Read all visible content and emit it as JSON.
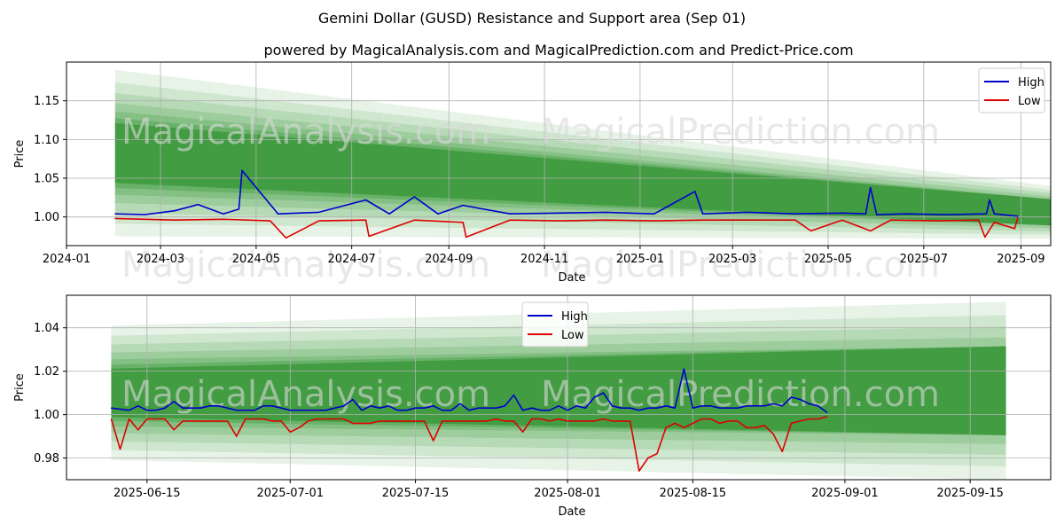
{
  "title": "Gemini Dollar (GUSD) Resistance and Support area (Sep 01)",
  "subtitle": "powered by MagicalAnalysis.com and MagicalPrediction.com and Predict-Price.com",
  "watermarks": [
    "MagicalAnalysis.com",
    "MagicalPrediction.com"
  ],
  "colors": {
    "high": "#0000cc",
    "low": "#dd0000",
    "band": "#228b22",
    "grid": "#b0b0b0"
  },
  "chart_data": [
    {
      "type": "line",
      "xlabel": "Date",
      "ylabel": "Price",
      "xlim": [
        "2024-01-01",
        "2025-09-20"
      ],
      "ylim": [
        0.963,
        1.2
      ],
      "x_ticks": [
        "2024-01",
        "2024-03",
        "2024-05",
        "2024-07",
        "2024-09",
        "2024-11",
        "2025-01",
        "2025-03",
        "2025-05",
        "2025-07",
        "2025-09"
      ],
      "y_ticks": [
        "1.00",
        "1.05",
        "1.10",
        "1.15"
      ],
      "legend": "top-right",
      "grid": true,
      "band": {
        "x_start": "2024-02-01",
        "x_end": "2025-09-20",
        "start_upper": 1.19,
        "start_lower": 0.975,
        "end_upper": 1.04,
        "end_lower": 0.972
      },
      "series": [
        {
          "name": "High",
          "x": [
            "2024-02-01",
            "2024-02-20",
            "2024-03-10",
            "2024-03-25",
            "2024-04-10",
            "2024-04-20",
            "2024-04-22",
            "2024-05-15",
            "2024-06-10",
            "2024-07-10",
            "2024-07-25",
            "2024-08-10",
            "2024-08-25",
            "2024-09-10",
            "2024-10-10",
            "2024-11-10",
            "2024-12-10",
            "2025-01-10",
            "2025-02-05",
            "2025-02-10",
            "2025-03-10",
            "2025-04-10",
            "2025-05-10",
            "2025-05-25",
            "2025-05-28",
            "2025-06-01",
            "2025-06-20",
            "2025-07-15",
            "2025-08-10",
            "2025-08-12",
            "2025-08-15",
            "2025-08-30"
          ],
          "values": [
            1.004,
            1.003,
            1.008,
            1.016,
            1.004,
            1.01,
            1.06,
            1.004,
            1.006,
            1.022,
            1.004,
            1.026,
            1.004,
            1.015,
            1.004,
            1.005,
            1.006,
            1.004,
            1.033,
            1.004,
            1.006,
            1.004,
            1.005,
            1.004,
            1.038,
            1.003,
            1.004,
            1.003,
            1.004,
            1.022,
            1.004,
            1.001
          ]
        },
        {
          "name": "Low",
          "x": [
            "2024-02-01",
            "2024-03-10",
            "2024-04-10",
            "2024-05-10",
            "2024-05-20",
            "2024-06-10",
            "2024-07-10",
            "2024-07-12",
            "2024-08-10",
            "2024-09-10",
            "2024-09-12",
            "2024-10-10",
            "2024-11-10",
            "2024-12-10",
            "2025-01-10",
            "2025-02-10",
            "2025-03-10",
            "2025-04-10",
            "2025-04-20",
            "2025-05-10",
            "2025-05-28",
            "2025-06-10",
            "2025-07-10",
            "2025-08-05",
            "2025-08-09",
            "2025-08-15",
            "2025-08-28",
            "2025-08-30"
          ],
          "values": [
            0.998,
            0.996,
            0.997,
            0.995,
            0.973,
            0.995,
            0.996,
            0.975,
            0.996,
            0.993,
            0.974,
            0.996,
            0.995,
            0.996,
            0.995,
            0.996,
            0.996,
            0.996,
            0.982,
            0.996,
            0.982,
            0.996,
            0.995,
            0.996,
            0.974,
            0.993,
            0.985,
            0.999
          ]
        }
      ]
    },
    {
      "type": "line",
      "xlabel": "Date",
      "ylabel": "Price",
      "xlim": [
        "2025-06-06",
        "2025-09-24"
      ],
      "ylim": [
        0.97,
        1.055
      ],
      "x_ticks": [
        "2025-06-15",
        "2025-07-01",
        "2025-07-15",
        "2025-08-01",
        "2025-08-15",
        "2025-09-01",
        "2025-09-15"
      ],
      "y_ticks": [
        "0.98",
        "1.00",
        "1.02",
        "1.04"
      ],
      "legend": "top-center",
      "grid": true,
      "band": {
        "x_start": "2025-06-11",
        "x_end": "2025-09-19",
        "start_upper": 1.041,
        "start_lower": 0.979,
        "end_upper": 1.052,
        "end_lower": 0.97
      },
      "series": [
        {
          "name": "High",
          "x": [
            "2025-06-11",
            "2025-06-13",
            "2025-06-14",
            "2025-06-15",
            "2025-06-16",
            "2025-06-17",
            "2025-06-18",
            "2025-06-19",
            "2025-06-20",
            "2025-06-21",
            "2025-06-22",
            "2025-06-23",
            "2025-06-24",
            "2025-06-25",
            "2025-06-26",
            "2025-06-27",
            "2025-06-28",
            "2025-06-29",
            "2025-06-30",
            "2025-07-01",
            "2025-07-02",
            "2025-07-03",
            "2025-07-04",
            "2025-07-05",
            "2025-07-06",
            "2025-07-07",
            "2025-07-08",
            "2025-07-09",
            "2025-07-10",
            "2025-07-11",
            "2025-07-12",
            "2025-07-13",
            "2025-07-14",
            "2025-07-15",
            "2025-07-16",
            "2025-07-17",
            "2025-07-18",
            "2025-07-19",
            "2025-07-20",
            "2025-07-21",
            "2025-07-22",
            "2025-07-23",
            "2025-07-24",
            "2025-07-25",
            "2025-07-26",
            "2025-07-27",
            "2025-07-28",
            "2025-07-29",
            "2025-07-30",
            "2025-07-31",
            "2025-08-01",
            "2025-08-02",
            "2025-08-03",
            "2025-08-04",
            "2025-08-05",
            "2025-08-06",
            "2025-08-07",
            "2025-08-08",
            "2025-08-09",
            "2025-08-10",
            "2025-08-11",
            "2025-08-12",
            "2025-08-13",
            "2025-08-14",
            "2025-08-15",
            "2025-08-16",
            "2025-08-17",
            "2025-08-18",
            "2025-08-19",
            "2025-08-20",
            "2025-08-21",
            "2025-08-22",
            "2025-08-23",
            "2025-08-24",
            "2025-08-25",
            "2025-08-26",
            "2025-08-27",
            "2025-08-28",
            "2025-08-29",
            "2025-08-30"
          ],
          "values": [
            1.003,
            1.002,
            1.004,
            1.002,
            1.002,
            1.003,
            1.006,
            1.003,
            1.003,
            1.003,
            1.004,
            1.004,
            1.003,
            1.002,
            1.002,
            1.002,
            1.004,
            1.004,
            1.003,
            1.002,
            1.002,
            1.002,
            1.002,
            1.002,
            1.003,
            1.004,
            1.007,
            1.002,
            1.004,
            1.003,
            1.004,
            1.002,
            1.002,
            1.003,
            1.003,
            1.004,
            1.002,
            1.002,
            1.005,
            1.002,
            1.003,
            1.003,
            1.003,
            1.004,
            1.009,
            1.002,
            1.003,
            1.002,
            1.002,
            1.004,
            1.002,
            1.004,
            1.003,
            1.008,
            1.01,
            1.004,
            1.003,
            1.003,
            1.002,
            1.003,
            1.003,
            1.004,
            1.003,
            1.021,
            1.003,
            1.004,
            1.004,
            1.003,
            1.003,
            1.003,
            1.004,
            1.004,
            1.004,
            1.005,
            1.004,
            1.008,
            1.007,
            1.005,
            1.004,
            1.001
          ]
        },
        {
          "name": "Low",
          "x": [
            "2025-06-11",
            "2025-06-12",
            "2025-06-13",
            "2025-06-14",
            "2025-06-15",
            "2025-06-16",
            "2025-06-17",
            "2025-06-18",
            "2025-06-19",
            "2025-06-20",
            "2025-06-21",
            "2025-06-22",
            "2025-06-23",
            "2025-06-24",
            "2025-06-25",
            "2025-06-26",
            "2025-06-27",
            "2025-06-28",
            "2025-06-29",
            "2025-06-30",
            "2025-07-01",
            "2025-07-02",
            "2025-07-03",
            "2025-07-04",
            "2025-07-05",
            "2025-07-06",
            "2025-07-07",
            "2025-07-08",
            "2025-07-09",
            "2025-07-10",
            "2025-07-11",
            "2025-07-12",
            "2025-07-13",
            "2025-07-14",
            "2025-07-15",
            "2025-07-16",
            "2025-07-17",
            "2025-07-18",
            "2025-07-19",
            "2025-07-20",
            "2025-07-21",
            "2025-07-22",
            "2025-07-23",
            "2025-07-24",
            "2025-07-25",
            "2025-07-26",
            "2025-07-27",
            "2025-07-28",
            "2025-07-29",
            "2025-07-30",
            "2025-07-31",
            "2025-08-01",
            "2025-08-02",
            "2025-08-03",
            "2025-08-04",
            "2025-08-05",
            "2025-08-06",
            "2025-08-07",
            "2025-08-08",
            "2025-08-09",
            "2025-08-10",
            "2025-08-11",
            "2025-08-12",
            "2025-08-13",
            "2025-08-14",
            "2025-08-15",
            "2025-08-16",
            "2025-08-17",
            "2025-08-18",
            "2025-08-19",
            "2025-08-20",
            "2025-08-21",
            "2025-08-22",
            "2025-08-23",
            "2025-08-24",
            "2025-08-25",
            "2025-08-26",
            "2025-08-27",
            "2025-08-28",
            "2025-08-29",
            "2025-08-30"
          ],
          "values": [
            0.998,
            0.984,
            0.998,
            0.993,
            0.998,
            0.998,
            0.998,
            0.993,
            0.997,
            0.997,
            0.997,
            0.997,
            0.997,
            0.997,
            0.99,
            0.998,
            0.998,
            0.998,
            0.997,
            0.997,
            0.992,
            0.994,
            0.997,
            0.998,
            0.998,
            0.998,
            0.998,
            0.996,
            0.996,
            0.996,
            0.997,
            0.997,
            0.997,
            0.997,
            0.997,
            0.997,
            0.988,
            0.997,
            0.997,
            0.997,
            0.997,
            0.997,
            0.997,
            0.998,
            0.997,
            0.997,
            0.992,
            0.998,
            0.998,
            0.997,
            0.998,
            0.997,
            0.997,
            0.997,
            0.997,
            0.998,
            0.997,
            0.997,
            0.997,
            0.974,
            0.98,
            0.982,
            0.994,
            0.996,
            0.994,
            0.996,
            0.998,
            0.998,
            0.996,
            0.997,
            0.997,
            0.994,
            0.994,
            0.995,
            0.991,
            0.983,
            0.996,
            0.997,
            0.998,
            0.998,
            0.999
          ]
        }
      ]
    }
  ]
}
